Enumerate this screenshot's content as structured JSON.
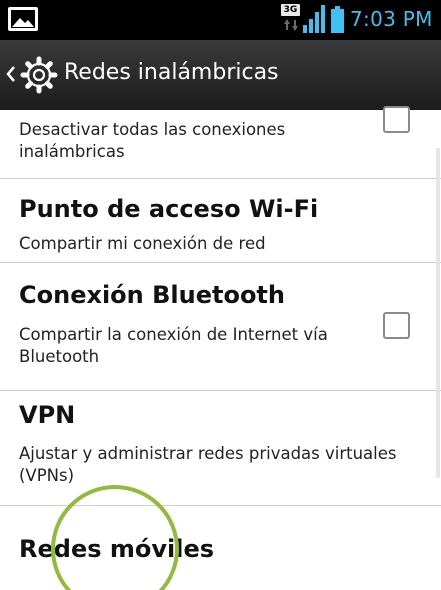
{
  "status_bar": {
    "network": "3G",
    "time": "7:03 PM",
    "icons": [
      "image-icon",
      "network-3g-icon",
      "data-arrows-icon",
      "signal-icon",
      "battery-icon"
    ],
    "accent_color": "#3ec0f0"
  },
  "header": {
    "title": "Redes inalámbricas",
    "icons": [
      "back-chevron-icon",
      "gear-icon"
    ]
  },
  "items": [
    {
      "title": "",
      "subtitle": "Desactivar todas las conexiones inalámbricas",
      "checkbox": true,
      "checked": false
    },
    {
      "title": "Punto de acceso Wi-Fi",
      "subtitle": "Compartir mi conexión de red",
      "checkbox": false
    },
    {
      "title": "Conexión Bluetooth",
      "subtitle": "Compartir la conexión de Internet vía Bluetooth",
      "checkbox": true,
      "checked": false
    },
    {
      "title": "VPN",
      "subtitle": "Ajustar y administrar redes privadas virtuales (VPNs)",
      "checkbox": false
    },
    {
      "title": "Redes móviles",
      "subtitle": "",
      "checkbox": false
    }
  ],
  "colors": {
    "highlight_circle": "#8fbd3a",
    "titlebar": "#2a2a2a"
  }
}
